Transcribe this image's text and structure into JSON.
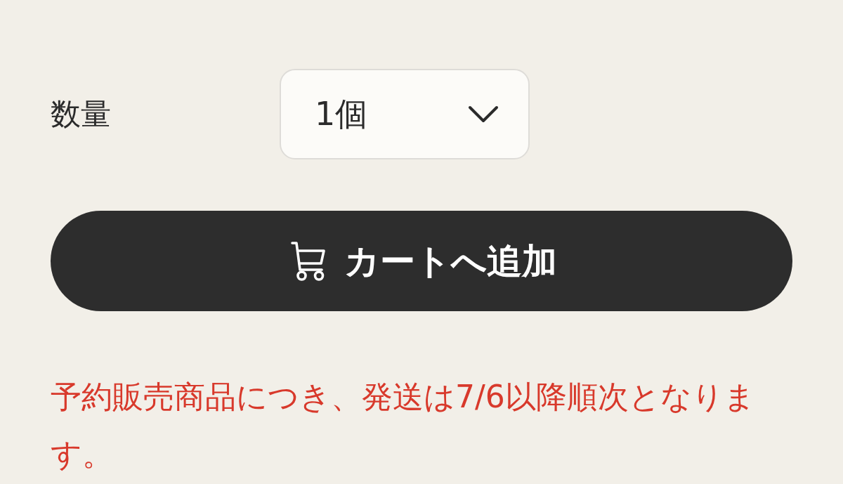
{
  "quantity": {
    "label": "数量",
    "value": "1個"
  },
  "add_to_cart_button": {
    "label": "カートへ追加"
  },
  "notice": "予約販売商品につき、発送は7/6以降順次となります。"
}
